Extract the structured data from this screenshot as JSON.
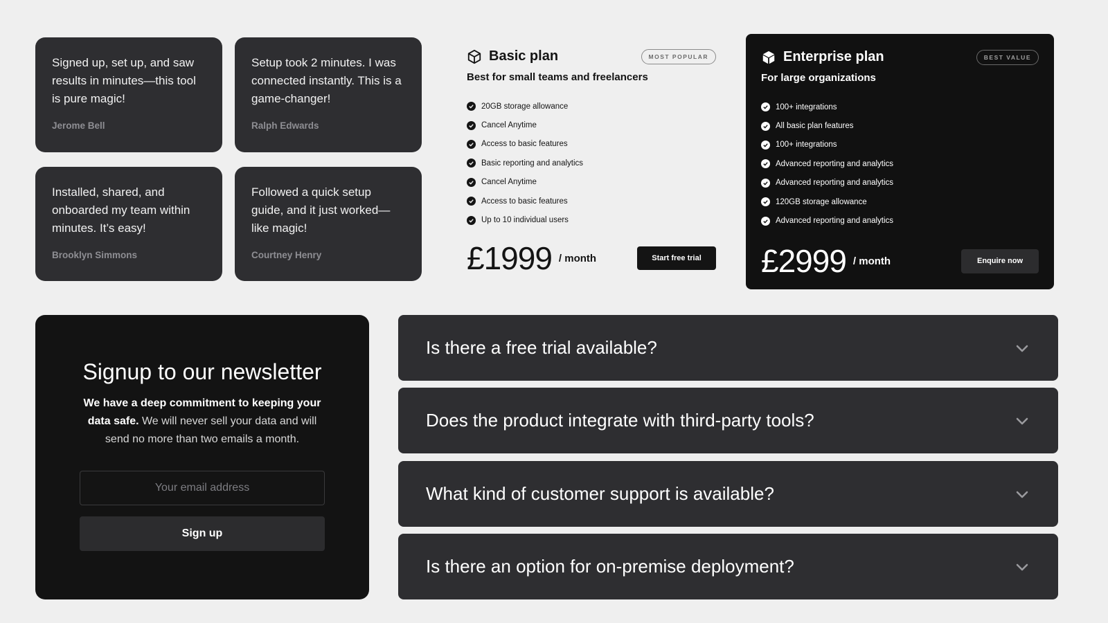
{
  "testimonials": [
    {
      "quote": "Signed up, set up, and saw results in minutes—this tool is pure magic!",
      "author": "Jerome Bell"
    },
    {
      "quote": "Setup took 2 minutes. I was connected instantly. This is a game-changer!",
      "author": "Ralph Edwards"
    },
    {
      "quote": "Installed, shared, and onboarded my team within minutes. It’s  easy!",
      "author": "Brooklyn Simmons"
    },
    {
      "quote": "Followed a quick setup guide, and it just worked—like magic!",
      "author": "Courtney Henry"
    }
  ],
  "plans": {
    "basic": {
      "name": "Basic plan",
      "badge": "MOST POPULAR",
      "subtitle": "Best for small teams and freelancers",
      "features": [
        "20GB storage allowance",
        "Cancel Anytime",
        "Access to basic features",
        "Basic reporting and analytics",
        "Cancel Anytime",
        "Access to basic features",
        "Up to 10 individual users"
      ],
      "price": "£1999",
      "period": "/ month",
      "cta": "Start free trial",
      "icon": "cube-outline-icon"
    },
    "enterprise": {
      "name": "Enterprise plan",
      "badge": "BEST VALUE",
      "subtitle": "For large organizations",
      "features": [
        "100+ integrations",
        "All basic plan features",
        "100+ integrations",
        "Advanced reporting and analytics",
        "Advanced reporting and analytics",
        "120GB storage allowance",
        "Advanced reporting and analytics"
      ],
      "price": "£2999",
      "period": "/ month",
      "cta": "Enquire now",
      "icon": "cube-filled-icon"
    }
  },
  "newsletter": {
    "title": "Signup to our newsletter",
    "body_bold": "We have a deep commitment to keeping your data safe.",
    "body_rest": " We will never sell your data and will send no more than two emails a month.",
    "email_placeholder": "Your email address",
    "button": "Sign up"
  },
  "faq": [
    {
      "question": "Is there a free trial available?"
    },
    {
      "question": "Does the product integrate with third-party tools?"
    },
    {
      "question": "What kind of customer support is available?"
    },
    {
      "question": "Is there an option for on-premise deployment?"
    }
  ],
  "colors": {
    "background": "#efefef",
    "card_dark": "#2e2e31",
    "panel_black": "#111111"
  }
}
